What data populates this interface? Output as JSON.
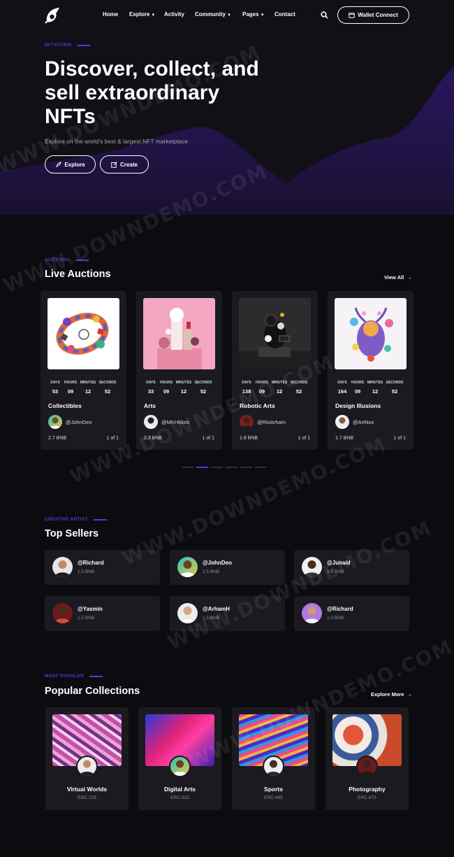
{
  "nav": {
    "items": [
      "Home",
      "Explore",
      "Activity",
      "Community",
      "Pages",
      "Contact"
    ],
    "wallet_label": "Wallet Connect"
  },
  "hero": {
    "kicker": "NFTSTORM",
    "title": "Discover, collect, and sell extraordinary NFTs",
    "subtitle": "Explore on the world's best & largest NFT marketplace",
    "explore_label": "Explore",
    "create_label": "Create"
  },
  "auctions": {
    "kicker": "AUCTIONS",
    "title": "Live Auctions",
    "view_all": "View All",
    "timer_labels": [
      "DAYS",
      "HOURS",
      "MINUTES",
      "SECONDS"
    ],
    "cards": [
      {
        "category": "Collectibles",
        "user": "@JohnDeo",
        "price": "2.7 BNB",
        "edition": "1 of 1",
        "timer": [
          "53",
          "09",
          "12",
          "52"
        ]
      },
      {
        "category": "Arts",
        "user": "@MKHblots",
        "price": "2.3 BNB",
        "edition": "1 of 1",
        "timer": [
          "33",
          "09",
          "12",
          "52"
        ]
      },
      {
        "category": "Robotic Arts",
        "user": "@RioArham",
        "price": "1.8 BNB",
        "edition": "1 of 1",
        "timer": [
          "138",
          "09",
          "12",
          "52"
        ]
      },
      {
        "category": "Design Illusions",
        "user": "@ArtNox",
        "price": "1.7 BNB",
        "edition": "1 of 1",
        "timer": [
          "164",
          "09",
          "12",
          "52"
        ]
      }
    ],
    "slider_total": 6,
    "slider_active": 1
  },
  "sellers": {
    "kicker": "CREATIVE ARTIST",
    "title": "Top Sellers",
    "items": [
      {
        "name": "@Richard",
        "balance": "1.5 BNB"
      },
      {
        "name": "@JohnDeo",
        "balance": "1.5 BNB"
      },
      {
        "name": "@Junaid",
        "balance": "1.5 BNB"
      },
      {
        "name": "@Yasmin",
        "balance": "1.5 BNB"
      },
      {
        "name": "@ArhamH",
        "balance": "1.5 BNB"
      },
      {
        "name": "@Richard",
        "balance": "1.5 BNB"
      }
    ]
  },
  "collections": {
    "kicker": "MOST POPULAR",
    "title": "Popular Collections",
    "explore_more": "Explore More",
    "items": [
      {
        "name": "Virtual Worlds",
        "code": "ERC-729"
      },
      {
        "name": "Digital Arts",
        "code": "ERC-522"
      },
      {
        "name": "Sports",
        "code": "ERC-495"
      },
      {
        "name": "Photography",
        "code": "ERC-873"
      }
    ]
  },
  "watermark": "WWW.DOWNDEMO.COM",
  "colors": {
    "accent": "#4a3bd8",
    "card": "#1a1a20",
    "background": "#0c0c10"
  }
}
